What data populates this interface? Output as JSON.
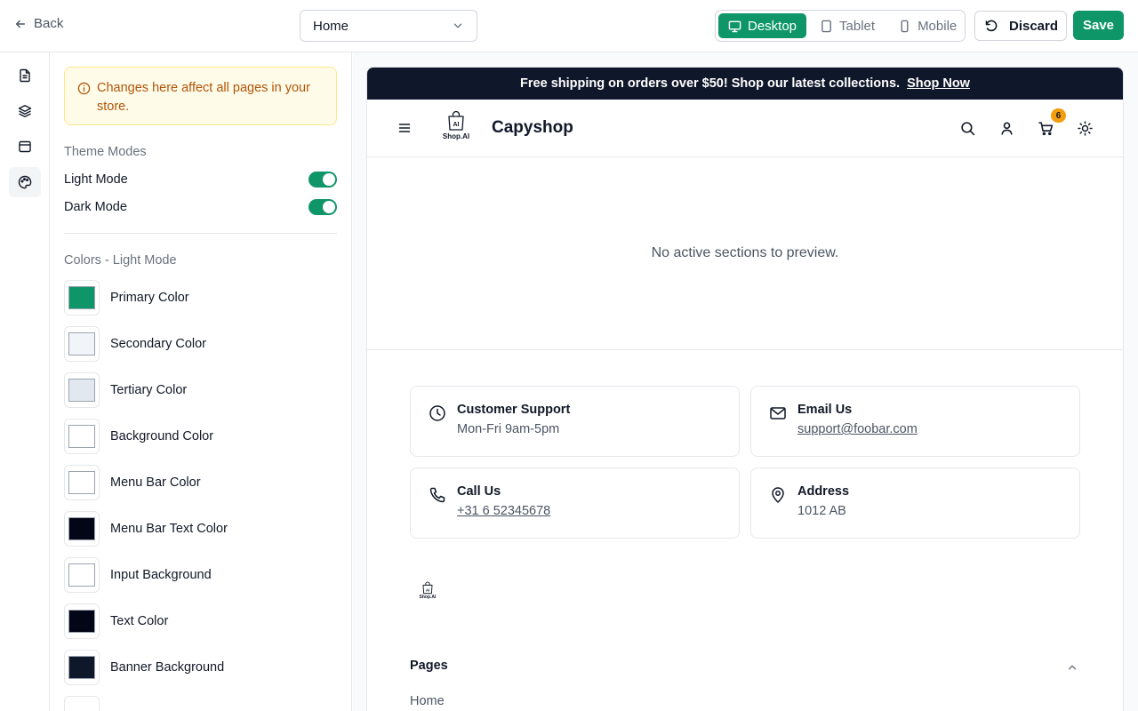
{
  "topbar": {
    "back_label": "Back",
    "page_select_value": "Home",
    "devices": [
      {
        "label": "Desktop",
        "active": true
      },
      {
        "label": "Tablet",
        "active": false
      },
      {
        "label": "Mobile",
        "active": false
      }
    ],
    "discard_label": "Discard",
    "save_label": "Save"
  },
  "rail": {
    "items": [
      "pages-icon",
      "layers-icon",
      "layout-icon",
      "palette-icon"
    ],
    "active_index": 3
  },
  "panel": {
    "notice": "Changes here affect all pages in your store.",
    "theme_modes_title": "Theme Modes",
    "modes": [
      {
        "label": "Light Mode",
        "enabled": true
      },
      {
        "label": "Dark Mode",
        "enabled": true
      }
    ],
    "colors_title": "Colors - Light Mode",
    "colors": [
      {
        "label": "Primary Color",
        "value": "#0f9668"
      },
      {
        "label": "Secondary Color",
        "value": "#f1f5f9"
      },
      {
        "label": "Tertiary Color",
        "value": "#e2e8f0"
      },
      {
        "label": "Background Color",
        "value": "#ffffff"
      },
      {
        "label": "Menu Bar Color",
        "value": "#ffffff"
      },
      {
        "label": "Menu Bar Text Color",
        "value": "#020617"
      },
      {
        "label": "Input Background",
        "value": "#ffffff"
      },
      {
        "label": "Text Color",
        "value": "#020617"
      },
      {
        "label": "Banner Background",
        "value": "#0f172a"
      }
    ]
  },
  "preview": {
    "announcement": "Free shipping on orders over $50! Shop our latest collections.",
    "announcement_link": "Shop Now",
    "logo_text": "Shop.AI",
    "store_name": "Capyshop",
    "cart_count": "6",
    "empty_message": "No active sections to preview.",
    "contact_cards": [
      {
        "icon": "clock-icon",
        "title": "Customer Support",
        "subtitle": "Mon-Fri 9am-5pm",
        "link": false
      },
      {
        "icon": "mail-icon",
        "title": "Email Us",
        "subtitle": "support@foobar.com",
        "link": true
      },
      {
        "icon": "phone-icon",
        "title": "Call Us",
        "subtitle": "+31 6 52345678",
        "link": true
      },
      {
        "icon": "map-pin-icon",
        "title": "Address",
        "subtitle": "1012 AB",
        "link": false
      }
    ],
    "footer_logo_text": "Shop.AI",
    "pages_title": "Pages",
    "pages_items": [
      "Home"
    ]
  },
  "colors": {
    "accent": "#0f9668",
    "banner": "#0f172a",
    "notice_bg": "#fefce8",
    "notice_text": "#b45309",
    "badge": "#f59e0b"
  }
}
